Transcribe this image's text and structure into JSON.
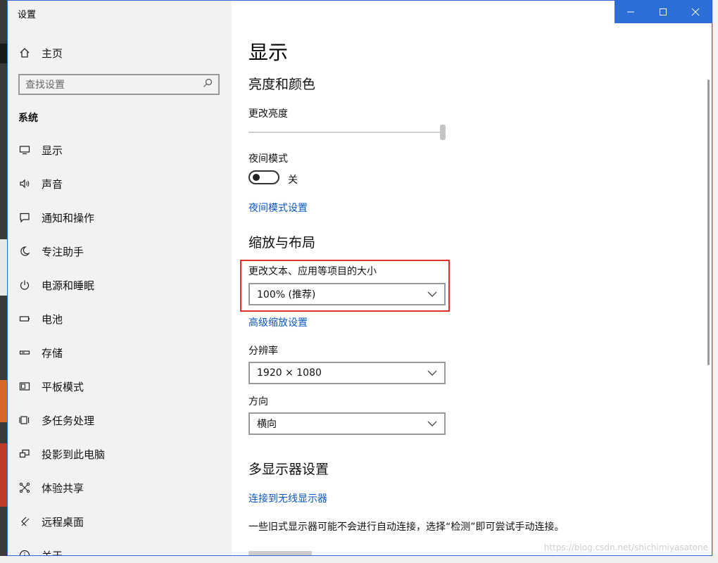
{
  "window": {
    "title": "设置"
  },
  "sidebar": {
    "home_label": "主页",
    "search_placeholder": "查找设置",
    "section": "系统",
    "items": [
      {
        "label": "显示",
        "icon": "monitor-icon"
      },
      {
        "label": "声音",
        "icon": "speaker-icon"
      },
      {
        "label": "通知和操作",
        "icon": "message-icon"
      },
      {
        "label": "专注助手",
        "icon": "moon-icon"
      },
      {
        "label": "电源和睡眠",
        "icon": "power-icon"
      },
      {
        "label": "电池",
        "icon": "battery-icon"
      },
      {
        "label": "存储",
        "icon": "storage-icon"
      },
      {
        "label": "平板模式",
        "icon": "tablet-icon"
      },
      {
        "label": "多任务处理",
        "icon": "multitask-icon"
      },
      {
        "label": "投影到此电脑",
        "icon": "project-icon"
      },
      {
        "label": "体验共享",
        "icon": "share-icon"
      },
      {
        "label": "远程桌面",
        "icon": "remote-icon"
      },
      {
        "label": "关于",
        "icon": "info-icon"
      }
    ]
  },
  "content": {
    "page_title": "显示",
    "brightness_section": "亮度和颜色",
    "brightness_label": "更改亮度",
    "brightness_value": 1.0,
    "night_mode_label": "夜间模式",
    "night_mode_state": "关",
    "night_mode_link": "夜间模式设置",
    "scale_section": "缩放与布局",
    "scale_label": "更改文本、应用等项目的大小",
    "scale_value": "100% (推荐)",
    "advanced_scale_link": "高级缩放设置",
    "resolution_label": "分辨率",
    "resolution_value": "1920 × 1080",
    "orientation_label": "方向",
    "orientation_value": "横向",
    "multi_display_section": "多显示器设置",
    "wireless_link": "连接到无线显示器",
    "multi_display_desc": "一些旧式显示器可能不会进行自动连接，选择“检测”即可尝试手动连接。"
  },
  "accent_color": "#0a56c2",
  "highlight_color": "#e0302a",
  "watermark": "https://blog.csdn.net/shichimiyasatone"
}
